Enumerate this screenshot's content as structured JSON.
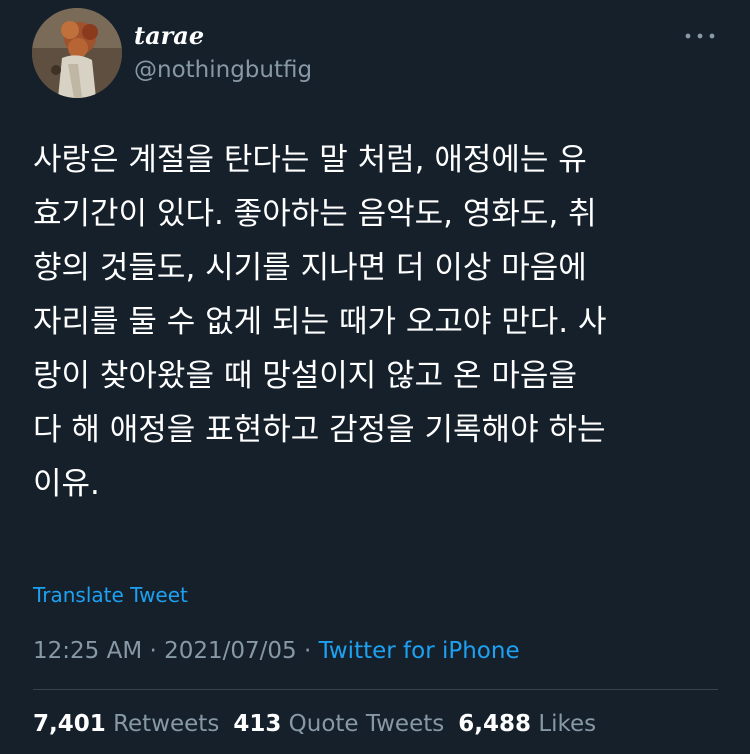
{
  "author": {
    "display_name": "tarae",
    "handle": "@nothingbutfig"
  },
  "tweet": {
    "text": "사랑은 계절을 탄다는 말 처럼, 애정에는 유\n효기간이 있다. 좋아하는 음악도, 영화도, 취\n향의 것들도, 시기를 지나면 더 이상 마음에\n자리를 둘 수 없게 되는 때가 오고야 만다. 사\n랑이 찾아왔을 때 망설이지 않고 온 마음을\n다 해 애정을 표현하고 감정을 기록해야 하는\n이유.",
    "translate_label": "Translate Tweet"
  },
  "meta": {
    "time": "12:25 AM",
    "sep1": " · ",
    "date": "2021/07/05",
    "sep2": " · ",
    "source": "Twitter for iPhone"
  },
  "stats": {
    "retweets_count": "7,401",
    "retweets_label": "Retweets",
    "quotes_count": "413",
    "quotes_label": "Quote Tweets",
    "likes_count": "6,488",
    "likes_label": "Likes"
  },
  "colors": {
    "background": "#15202b",
    "accent": "#1da1f2",
    "secondary_text": "#8899a6",
    "divider": "#38444d"
  },
  "icons": {
    "more": "more-horizontal-icon"
  }
}
